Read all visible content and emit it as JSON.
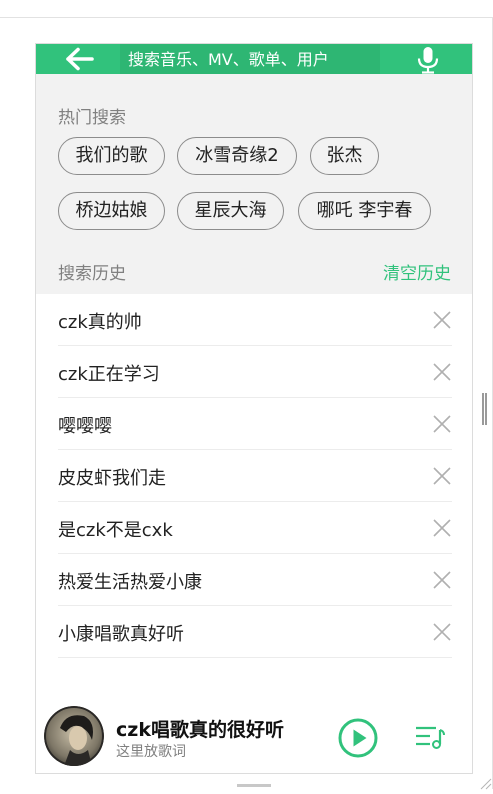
{
  "header": {
    "search_placeholder": "搜索音乐、MV、歌单、用户",
    "back_icon": "arrow-left-icon",
    "mic_icon": "microphone-icon"
  },
  "hot_search": {
    "title": "热门搜索",
    "tags": [
      "我们的歌",
      "冰雪奇缘2",
      "张杰",
      "桥边姑娘",
      "星辰大海",
      "哪吒 李宇春"
    ]
  },
  "history": {
    "title": "搜索历史",
    "clear_label": "清空历史",
    "items": [
      "czk真的帅",
      "czk正在学习",
      "嘤嘤嘤",
      "皮皮虾我们走",
      "是czk不是cxk",
      "热爱生活热爱小康",
      "小康唱歌真好听"
    ]
  },
  "player": {
    "song_title": "czk唱歌真的很好听",
    "lyric": "这里放歌词",
    "play_icon": "play-circle-icon",
    "playlist_icon": "playlist-icon"
  },
  "colors": {
    "accent": "#31c27c",
    "search_box": "#2eb673",
    "page_bg": "#f2f2f2"
  }
}
